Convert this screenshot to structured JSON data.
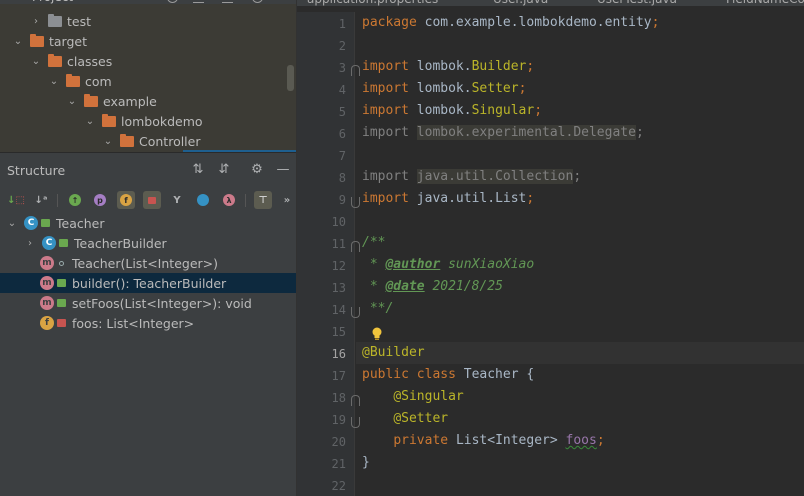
{
  "project": {
    "tree": [
      {
        "label": "test",
        "depth": 2,
        "chevron": "right",
        "folder": "gray"
      },
      {
        "label": "target",
        "depth": 1,
        "chevron": "down",
        "folder": "orange"
      },
      {
        "label": "classes",
        "depth": 2,
        "chevron": "down",
        "folder": "orange"
      },
      {
        "label": "com",
        "depth": 3,
        "chevron": "down",
        "folder": "orange"
      },
      {
        "label": "example",
        "depth": 4,
        "chevron": "down",
        "folder": "orange"
      },
      {
        "label": "lombokdemo",
        "depth": 5,
        "chevron": "down",
        "folder": "orange"
      },
      {
        "label": "Controller",
        "depth": 6,
        "chevron": "down",
        "folder": "orange"
      }
    ]
  },
  "structure": {
    "title": "Structure",
    "items": [
      {
        "label": "Teacher",
        "badge": "C",
        "badge_type": "c",
        "access": "green",
        "chevron": "down",
        "selected": false
      },
      {
        "label": "TeacherBuilder",
        "badge": "C",
        "badge_type": "c",
        "access": "green",
        "chevron": "right",
        "selected": false
      },
      {
        "label": "Teacher(List<Integer>)",
        "badge": "m",
        "badge_type": "m",
        "access": "circle",
        "chevron": "",
        "selected": false
      },
      {
        "label": "builder(): TeacherBuilder",
        "badge": "m",
        "badge_type": "m",
        "access": "green",
        "chevron": "",
        "selected": true
      },
      {
        "label": "setFoos(List<Integer>): void",
        "badge": "m",
        "badge_type": "m",
        "access": "green",
        "chevron": "",
        "selected": false
      },
      {
        "label": "foos: List<Integer>",
        "badge": "f",
        "badge_type": "f",
        "access": "red",
        "chevron": "",
        "selected": false
      }
    ]
  },
  "editor": {
    "tabs": [
      "application.properties",
      "User.java",
      "UserTest.java",
      "FieldNameCo"
    ],
    "current_line": 16,
    "lines": [
      {
        "n": 1,
        "tokens": [
          [
            "kw",
            "package "
          ],
          [
            "",
            "com.example.lombokdemo.entity"
          ],
          [
            "kw",
            ";"
          ]
        ]
      },
      {
        "n": 2,
        "tokens": []
      },
      {
        "n": 3,
        "tokens": [
          [
            "kw",
            "import "
          ],
          [
            "",
            "lombok."
          ],
          [
            "cls",
            "Builder"
          ],
          [
            "kw",
            ";"
          ]
        ]
      },
      {
        "n": 4,
        "tokens": [
          [
            "kw",
            "import "
          ],
          [
            "",
            "lombok."
          ],
          [
            "cls",
            "Setter"
          ],
          [
            "kw",
            ";"
          ]
        ]
      },
      {
        "n": 5,
        "tokens": [
          [
            "kw",
            "import "
          ],
          [
            "",
            "lombok."
          ],
          [
            "cls",
            "Singular"
          ],
          [
            "kw",
            ";"
          ]
        ]
      },
      {
        "n": 6,
        "tokens": [
          [
            "unused",
            "import "
          ],
          [
            "unused-bg",
            "lombok.experimental.Delegate"
          ],
          [
            "unused",
            ";"
          ]
        ]
      },
      {
        "n": 7,
        "tokens": []
      },
      {
        "n": 8,
        "tokens": [
          [
            "unused",
            "import "
          ],
          [
            "unused-bg",
            "java.util.Collection"
          ],
          [
            "unused",
            ";"
          ]
        ]
      },
      {
        "n": 9,
        "tokens": [
          [
            "kw",
            "import "
          ],
          [
            "",
            "java.util.List"
          ],
          [
            "kw",
            ";"
          ]
        ]
      },
      {
        "n": 10,
        "tokens": []
      },
      {
        "n": 11,
        "tokens": [
          [
            "doc",
            "/**"
          ]
        ]
      },
      {
        "n": 12,
        "tokens": [
          [
            "doc",
            " * "
          ],
          [
            "doctag",
            "@author"
          ],
          [
            "doc",
            " sunXiaoXiao"
          ]
        ]
      },
      {
        "n": 13,
        "tokens": [
          [
            "doc",
            " * "
          ],
          [
            "doctag",
            "@date"
          ],
          [
            "doc",
            " 2021/8/25"
          ]
        ]
      },
      {
        "n": 14,
        "tokens": [
          [
            "doc",
            " **/"
          ]
        ]
      },
      {
        "n": 15,
        "tokens": []
      },
      {
        "n": 16,
        "tokens": [
          [
            "ann",
            "@Builder"
          ]
        ]
      },
      {
        "n": 17,
        "tokens": [
          [
            "kw",
            "public class "
          ],
          [
            "",
            "Teacher {"
          ]
        ]
      },
      {
        "n": 18,
        "tokens": [
          [
            "",
            "    "
          ],
          [
            "ann",
            "@Singular"
          ]
        ]
      },
      {
        "n": 19,
        "tokens": [
          [
            "",
            "    "
          ],
          [
            "ann",
            "@Setter"
          ]
        ]
      },
      {
        "n": 20,
        "tokens": [
          [
            "",
            "    "
          ],
          [
            "kw",
            "private "
          ],
          [
            "",
            "List<Integer> "
          ],
          [
            "field",
            "foos"
          ],
          [
            "kw",
            ";"
          ]
        ]
      },
      {
        "n": 21,
        "tokens": [
          [
            "",
            "}"
          ]
        ]
      },
      {
        "n": 22,
        "tokens": []
      }
    ]
  },
  "colors": {
    "keyword": "#cc7832",
    "annotation": "#bbb529",
    "doc": "#629755",
    "field": "#9876aa",
    "text": "#a9b7c6",
    "selection": "#0d293e"
  }
}
